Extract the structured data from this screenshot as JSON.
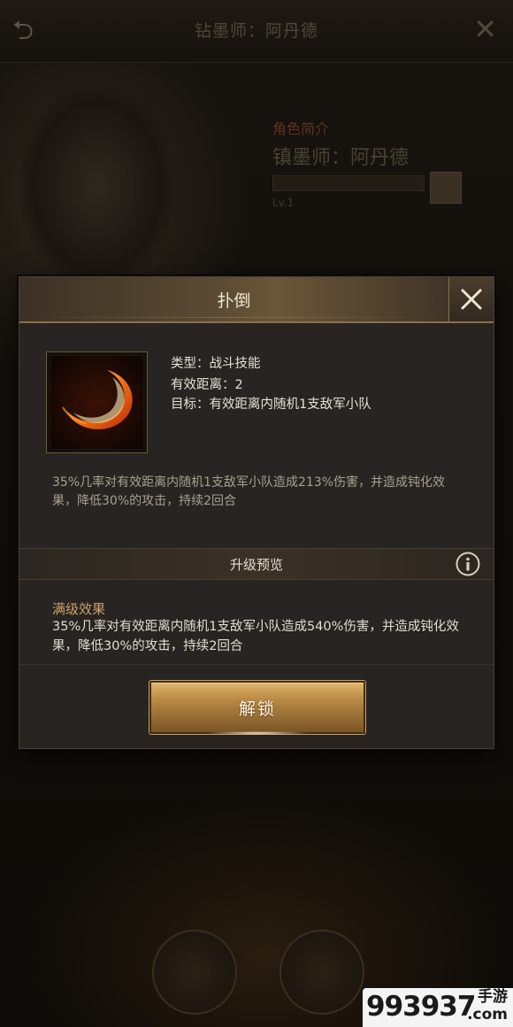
{
  "background": {
    "title": "钻墨师：阿丹德",
    "info_label": "角色简介",
    "info_name": "镇墨师：阿丹德",
    "level": "Lv.1"
  },
  "modal": {
    "title": "扑倒",
    "skill": {
      "icon": "fire-slash-icon",
      "type_line": "类型：战斗技能",
      "range_line": "有效距离：2",
      "target_line": "目标：有效距离内随机1支敌军小队",
      "description": "35%几率对有效距离内随机1支敌军小队造成213%伤害，并造成钝化效果，降低30%的攻击，持续2回合"
    },
    "upgrade_preview": {
      "title": "升级预览",
      "label": "满级效果",
      "text": "35%几率对有效距离内随机1支敌军小队造成540%伤害，并造成钝化效果，降低30%的攻击，持续2回合"
    },
    "unlock_button": "解锁"
  },
  "watermark": {
    "number": "993937",
    "text_top": "手游",
    "text_bottom": ".com"
  },
  "colors": {
    "accent_gold": "#c9a46b",
    "panel_bg": "#272421",
    "button_gold": "#b88a45"
  }
}
